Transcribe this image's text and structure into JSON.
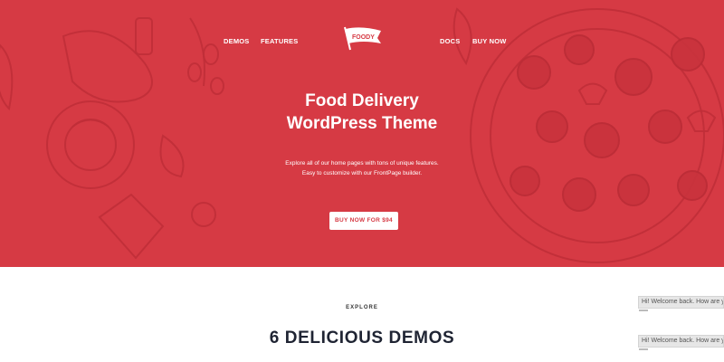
{
  "nav": {
    "demos": "DEMOS",
    "features": "FEATURES",
    "docs": "DOCS",
    "buy_now": "BUY NOW"
  },
  "logo": {
    "text": "FOODY"
  },
  "hero": {
    "title_line1": "Food Delivery",
    "title_line2": "WordPress Theme",
    "subtitle_line1": "Explore all of our home pages with tons of unique features.",
    "subtitle_line2": "Easy to customize with our FrontPage builder.",
    "button": "BUY NOW FOR $94"
  },
  "section": {
    "eyebrow": "EXPLORE",
    "title": "6 DELICIOUS DEMOS"
  },
  "chat": {
    "message1": "Hi! Welcome back. How are you",
    "message2": "Hi! Welcome back. How are you"
  },
  "colors": {
    "hero_bg": "#d63a44",
    "heading_dark": "#1f2433"
  }
}
